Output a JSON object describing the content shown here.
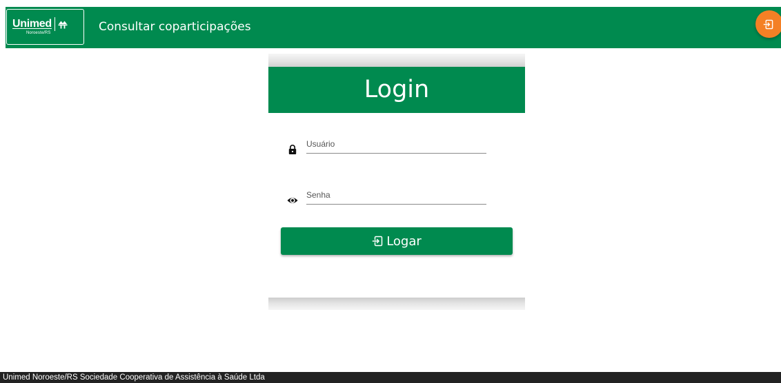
{
  "header": {
    "logo": {
      "name": "Unimed",
      "region": "Noroeste/RS"
    },
    "title": "Consultar coparticipações",
    "exit_icon": "exit-icon",
    "bg_color": "#008a4f",
    "fab_color": "#f48025"
  },
  "login_card": {
    "title": "Login",
    "username": {
      "placeholder": "Usuário",
      "value": "",
      "icon": "lock-icon"
    },
    "password": {
      "placeholder": "Senha",
      "value": "",
      "icon": "eye-icon"
    },
    "submit": {
      "label": "Logar",
      "icon": "login-icon"
    }
  },
  "footer": {
    "text": "Unimed Noroeste/RS Sociedade Cooperativa de Assistência à Saúde Ltda"
  }
}
